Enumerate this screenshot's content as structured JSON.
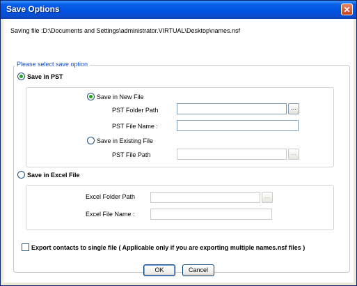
{
  "window": {
    "title": "Save Options",
    "close_glyph": "✕"
  },
  "saving_file": "Saving file :D:\\Documents and Settings\\administrator.VIRTUAL\\Desktop\\names.nsf",
  "options": {
    "legend": "Please select save option",
    "pst": {
      "label": "Save in PST",
      "selected": true,
      "new_file": {
        "label": "Save in New File",
        "selected": true,
        "folder_label": "PST Folder Path",
        "folder_value": "",
        "file_name_label": "PST File Name :",
        "file_name_value": "",
        "browse_label": "..."
      },
      "existing_file": {
        "label": "Save in Existing File",
        "selected": false,
        "file_path_label": "PST File Path",
        "file_path_value": "",
        "browse_label": "..."
      }
    },
    "excel": {
      "label": "Save in Excel File",
      "selected": false,
      "folder_label": "Excel Folder Path",
      "folder_value": "",
      "file_name_label": "Excel File Name :",
      "file_name_value": "",
      "browse_label": "..."
    },
    "export_single": {
      "label": "Export contacts to single file ( Applicable only if you are exporting multiple names.nsf files )",
      "checked": false
    }
  },
  "buttons": {
    "ok": "OK",
    "cancel": "Cancel"
  },
  "colors": {
    "titlebar": "#0054e3",
    "legend": "#1650c8",
    "radio_dot": "#21a121"
  }
}
